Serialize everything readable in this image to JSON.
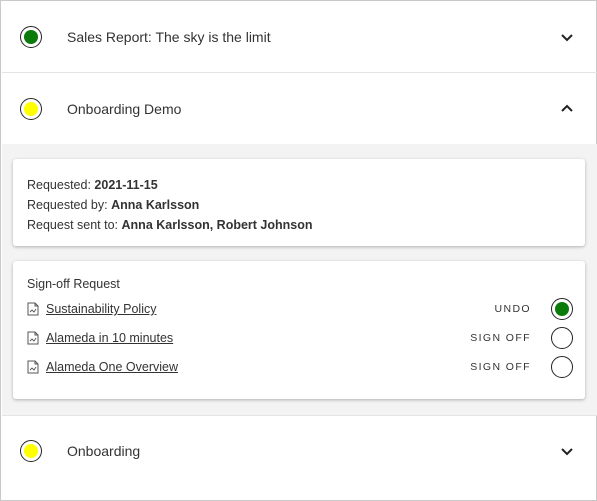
{
  "colors": {
    "green": "#0a7a0a",
    "yellow": "#ffff00"
  },
  "items": [
    {
      "title": "Sales Report: The sky is the limit",
      "status_color": "#0a7a0a",
      "state": "collapsed",
      "chevron": "chevron-down-icon"
    },
    {
      "title": "Onboarding Demo",
      "status_color": "#ffff00",
      "state": "expanded",
      "chevron": "chevron-up-icon"
    },
    {
      "title": "Onboarding",
      "status_color": "#ffff00",
      "state": "collapsed",
      "chevron": "chevron-down-icon"
    }
  ],
  "details": {
    "requested_label": "Requested:",
    "requested_value": "2021-11-15",
    "requested_by_label": "Requested by:",
    "requested_by_value": "Anna Karlsson",
    "sent_to_label": "Request sent to:",
    "sent_to_value": "Anna Karlsson, Robert Johnson"
  },
  "signoff": {
    "title": "Sign-off Request",
    "documents": [
      {
        "name": "Sustainability Policy",
        "action": "UNDO",
        "signed": true
      },
      {
        "name": "Alameda in 10 minutes",
        "action": "SIGN OFF",
        "signed": false
      },
      {
        "name": "Alameda One Overview",
        "action": "SIGN OFF",
        "signed": false
      }
    ]
  }
}
